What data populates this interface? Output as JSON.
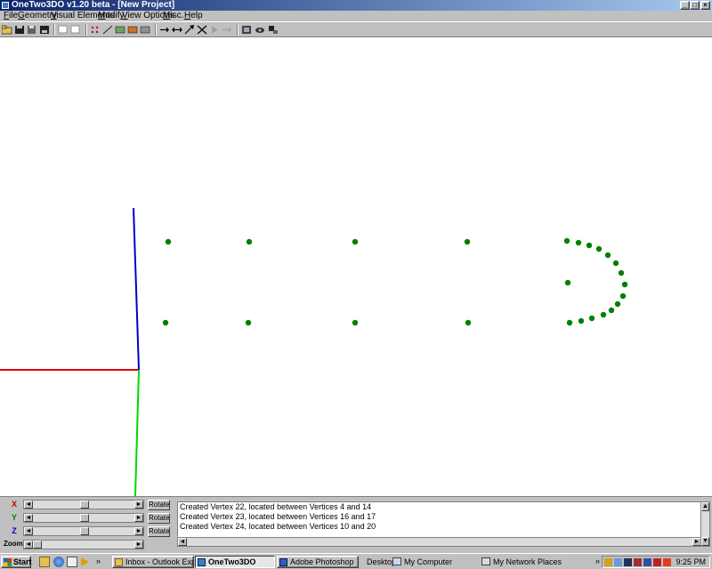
{
  "window": {
    "title": "OneTwo3DO  v1.20 beta - [New Project]",
    "min_glyph": "_",
    "restore_glyph": "□",
    "close_glyph": "×"
  },
  "menu": [
    "File",
    "Geometry",
    "Visual Elements",
    "Modify",
    "View Options",
    "Misc.",
    "Help"
  ],
  "toolbar": {
    "icons": [
      "open-icon",
      "save-icon",
      "save-as-icon",
      "export-icon",
      "undo-icon",
      "redo-icon",
      "vertex-grid-icon",
      "line-icon",
      "face-icon",
      "texture-icon",
      "surface-icon",
      "move-arrow-icon",
      "move-both-icon",
      "scale-icon",
      "cross-icon",
      "play-icon",
      "forward-icon",
      "render-icon",
      "camera-icon",
      "settings-icon"
    ]
  },
  "viewport": {
    "axis_colors": {
      "x": "#e00000",
      "y": "#00d800",
      "z": "#0000c8"
    },
    "vertex_color": "#008000",
    "vertices": [
      [
        189,
        272
      ],
      [
        280,
        272
      ],
      [
        399,
        272
      ],
      [
        525,
        272
      ],
      [
        186,
        363
      ],
      [
        279,
        363
      ],
      [
        399,
        363
      ],
      [
        526,
        363
      ],
      [
        638,
        318
      ],
      [
        637,
        271
      ],
      [
        650,
        273
      ],
      [
        662,
        276
      ],
      [
        673,
        280
      ],
      [
        683,
        287
      ],
      [
        692,
        296
      ],
      [
        698,
        307
      ],
      [
        702,
        320
      ],
      [
        700,
        333
      ],
      [
        694,
        342
      ],
      [
        687,
        349
      ],
      [
        678,
        354
      ],
      [
        665,
        358
      ],
      [
        653,
        361
      ],
      [
        640,
        363
      ]
    ]
  },
  "controls": {
    "x_label": "X",
    "y_label": "Y",
    "z_label": "Z",
    "zoom_label": "Zoom",
    "rotate_label": "Rotate",
    "left_arrow": "◄",
    "right_arrow": "►"
  },
  "log": [
    "Created Vertex 22, located between Vertices 4 and 14",
    "Created Vertex 23, located between Vertices 16 and 17",
    "Created Vertex 24, located between Vertices 10 and 20"
  ],
  "taskbar": {
    "start_label": "Start",
    "tasks": [
      {
        "label": "Inbox - Outlook Express",
        "icon": "outlook-icon",
        "active": false
      },
      {
        "label": "OneTwo3DO",
        "icon": "onetwo3do-icon",
        "active": true
      },
      {
        "label": "Adobe Photoshop",
        "icon": "photoshop-icon",
        "active": false
      }
    ],
    "desktop_items": [
      "Desktop",
      "My Computer",
      "My Network Places"
    ],
    "chevron": "»",
    "clock": "9:25 PM"
  }
}
